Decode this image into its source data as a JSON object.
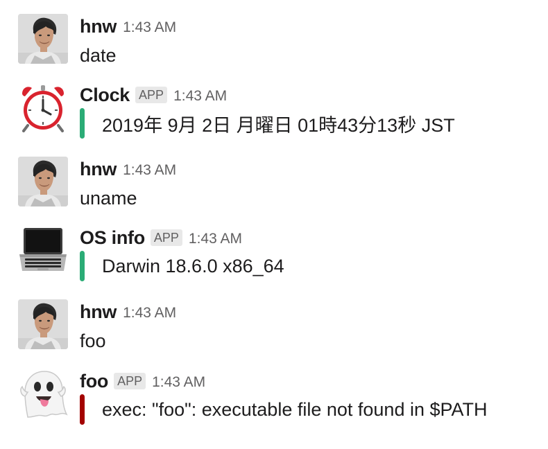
{
  "colors": {
    "success_bar": "#2bac76",
    "error_bar": "#a30200",
    "badge_bg": "#e8e8e8",
    "timestamp": "#616061"
  },
  "messages": [
    {
      "user": "hnw",
      "avatar_icon": "person-photo",
      "time": "1:43 AM",
      "is_app": false,
      "text": "date"
    },
    {
      "user": "Clock",
      "avatar_icon": "alarm-clock-emoji",
      "time": "1:43 AM",
      "is_app": true,
      "badge": "APP",
      "attachment": {
        "status": "success",
        "text": "2019年 9月 2日 月曜日 01時43分13秒 JST"
      }
    },
    {
      "user": "hnw",
      "avatar_icon": "person-photo",
      "time": "1:43 AM",
      "is_app": false,
      "text": "uname"
    },
    {
      "user": "OS info",
      "avatar_icon": "laptop-emoji",
      "time": "1:43 AM",
      "is_app": true,
      "badge": "APP",
      "attachment": {
        "status": "success",
        "text": "Darwin 18.6.0 x86_64"
      }
    },
    {
      "user": "hnw",
      "avatar_icon": "person-photo",
      "time": "1:43 AM",
      "is_app": false,
      "text": "foo"
    },
    {
      "user": "foo",
      "avatar_icon": "ghost-emoji",
      "time": "1:43 AM",
      "is_app": true,
      "badge": "APP",
      "attachment": {
        "status": "error",
        "text": "exec: \"foo\": executable file not found in $PATH"
      }
    }
  ]
}
